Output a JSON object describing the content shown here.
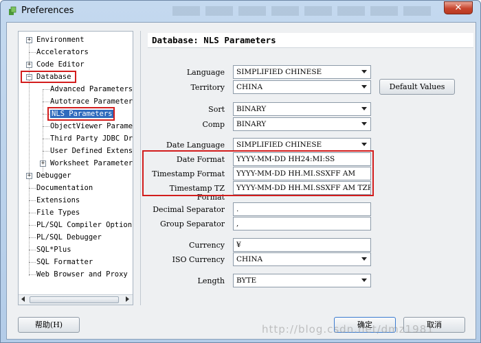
{
  "window": {
    "title": "Preferences",
    "close_glyph": "✕"
  },
  "tree": {
    "items": [
      {
        "label": "Environment",
        "expander": "+"
      },
      {
        "label": "Accelerators"
      },
      {
        "label": "Code Editor",
        "expander": "+"
      },
      {
        "label": "Database",
        "expander": "−"
      },
      {
        "label": "Advanced Parameters"
      },
      {
        "label": "Autotrace Parameters"
      },
      {
        "label": "NLS Parameters"
      },
      {
        "label": "ObjectViewer Paramete"
      },
      {
        "label": "Third Party JDBC Driv"
      },
      {
        "label": "User Defined Extensio"
      },
      {
        "label": "Worksheet Parameters",
        "expander": "+"
      },
      {
        "label": "Debugger",
        "expander": "+"
      },
      {
        "label": "Documentation"
      },
      {
        "label": "Extensions"
      },
      {
        "label": "File Types"
      },
      {
        "label": "PL/SQL Compiler Options"
      },
      {
        "label": "PL/SQL Debugger"
      },
      {
        "label": "SQL*Plus"
      },
      {
        "label": "SQL Formatter"
      },
      {
        "label": "Web Browser and Proxy"
      }
    ],
    "selected": "NLS Parameters"
  },
  "panel": {
    "header": "Database: NLS Parameters",
    "language": {
      "label": "Language",
      "value": "SIMPLIFIED CHINESE"
    },
    "territory": {
      "label": "Territory",
      "value": "CHINA"
    },
    "default_values_label": "Default Values",
    "sort": {
      "label": "Sort",
      "value": "BINARY"
    },
    "comp": {
      "label": "Comp",
      "value": "BINARY"
    },
    "date_language": {
      "label": "Date Language",
      "value": "SIMPLIFIED CHINESE"
    },
    "date_format": {
      "label": "Date Format",
      "value": "YYYY-MM-DD HH24:MI:SS"
    },
    "timestamp_format": {
      "label": "Timestamp Format",
      "value": "YYYY-MM-DD HH.MI.SSXFF AM"
    },
    "timestamp_tz_format": {
      "label": "Timestamp TZ Format",
      "value": "YYYY-MM-DD HH.MI.SSXFF AM TZR"
    },
    "decimal_separator": {
      "label": "Decimal Separator",
      "value": "."
    },
    "group_separator": {
      "label": "Group Separator",
      "value": ","
    },
    "currency": {
      "label": "Currency",
      "value": "¥"
    },
    "iso_currency": {
      "label": "ISO Currency",
      "value": "CHINA"
    },
    "length": {
      "label": "Length",
      "value": "BYTE"
    }
  },
  "footer": {
    "help_label": "帮助(H)",
    "ok_label": "确定",
    "cancel_label": "取消"
  },
  "watermark": "http://blog.csdn.net/dmz1981"
}
